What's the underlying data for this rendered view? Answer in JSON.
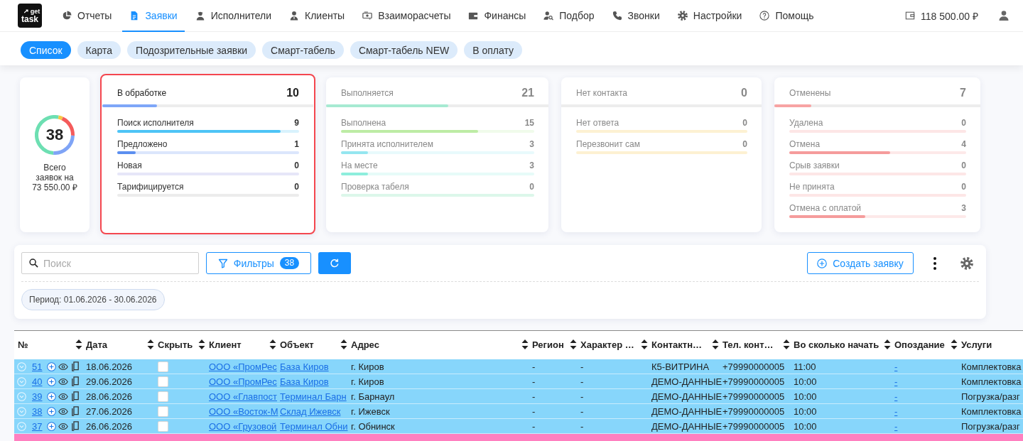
{
  "header": {
    "logo": {
      "top": "get",
      "bottom": "task"
    },
    "nav": [
      {
        "label": "Отчеты",
        "selected": false
      },
      {
        "label": "Заявки",
        "selected": true
      },
      {
        "label": "Исполнители",
        "selected": false
      },
      {
        "label": "Клиенты",
        "selected": false
      },
      {
        "label": "Взаиморасчеты",
        "selected": false
      },
      {
        "label": "Финансы",
        "selected": false
      },
      {
        "label": "Подбор",
        "selected": false
      },
      {
        "label": "Звонки",
        "selected": false
      },
      {
        "label": "Настройки",
        "selected": false
      },
      {
        "label": "Помощь",
        "selected": false
      }
    ],
    "balance": "118 500.00 ₽"
  },
  "view_tabs": [
    {
      "label": "Список",
      "selected": true
    },
    {
      "label": "Карта",
      "selected": false
    },
    {
      "label": "Подозрительные заявки",
      "selected": false
    },
    {
      "label": "Смарт-табель",
      "selected": false
    },
    {
      "label": "Смарт-табель NEW",
      "selected": false
    },
    {
      "label": "В оплату",
      "selected": false
    }
  ],
  "summary": {
    "total": {
      "count": "38",
      "caption": "Всего заявок на 73 550.00 ₽"
    },
    "groups": [
      {
        "title": "В обработке",
        "count": "10",
        "level": 0.26,
        "color": "#7ea6f8",
        "selected": true,
        "items": [
          {
            "label": "Поиск исполнителя",
            "count": "9",
            "level": 0.9,
            "color": "#4ec4f6"
          },
          {
            "label": "Предложено",
            "count": "1",
            "level": 0.1,
            "color": "#5b8ff0"
          },
          {
            "label": "Новая",
            "count": "0",
            "color": "#e6e6f8"
          },
          {
            "label": "Тарифицируется",
            "count": "0",
            "color": "#ececec"
          }
        ]
      },
      {
        "title": "Выполняется",
        "count": "21",
        "level": 0.55,
        "color": "#a6ead2",
        "selected": false,
        "items": [
          {
            "label": "Выполнена",
            "count": "15",
            "level": 0.71,
            "color": "#bdeca5"
          },
          {
            "label": "Принята исполнителем",
            "count": "3",
            "level": 0.14,
            "color": "#95e6f0"
          },
          {
            "label": "На месте",
            "count": "3",
            "level": 0.14,
            "color": "#8eeedd"
          },
          {
            "label": "Проверка табеля",
            "count": "0",
            "color": "#dcf7ea"
          }
        ]
      },
      {
        "title": "Нет контакта",
        "count": "0",
        "selected": false,
        "items": [
          {
            "label": "Нет ответа",
            "count": "0",
            "color": "#fdf1d2"
          },
          {
            "label": "Перезвонит сам",
            "count": "0",
            "color": "#fdf1d2"
          }
        ]
      },
      {
        "title": "Отменены",
        "count": "7",
        "level": 0.18,
        "color": "#f7a3a3",
        "selected": false,
        "items": [
          {
            "label": "Удалена",
            "count": "0",
            "color": "#fde6e6"
          },
          {
            "label": "Отмена",
            "count": "4",
            "level": 0.57,
            "color": "#f59c9c"
          },
          {
            "label": "Срыв заявки",
            "count": "0",
            "color": "#fde6e6"
          },
          {
            "label": "Не принята",
            "count": "0",
            "color": "#fde6e6"
          },
          {
            "label": "Отмена с оплатой",
            "count": "3",
            "level": 0.43,
            "color": "#f59c9c"
          }
        ]
      }
    ]
  },
  "toolbar": {
    "search_placeholder": "Поиск",
    "filters": {
      "label": "Фильтры",
      "count": "38"
    },
    "create_label": "Создать заявку",
    "period": "Период: 01.06.2026 - 30.06.2026"
  },
  "table": {
    "columns": [
      "№",
      "Дата",
      "Скрыть",
      "Клиент",
      "Объект",
      "Адрес",
      "Регион",
      "Характер …",
      "Контактн…",
      "Тел. конт…",
      "Во сколько начать",
      "Опоздание",
      "Услуги"
    ],
    "rows": [
      {
        "color": "#87d6fb",
        "number": "51",
        "date": "18.06.2026",
        "hidden": false,
        "client": "ООО «ПромРес",
        "object": "База Киров",
        "address": "г. Киров",
        "region": "-",
        "character": "-",
        "contact": "К5-ВИТРИНА",
        "phone": "+79990000005",
        "start_time": "11:00",
        "delay": "-",
        "services": "Комплектовка"
      },
      {
        "color": "#87d6fb",
        "number": "40",
        "date": "29.06.2026",
        "hidden": false,
        "client": "ООО «ПромРес",
        "object": "База Киров",
        "address": "г. Киров",
        "region": "-",
        "character": "-",
        "contact": "ДЕМО-ДАННЫЕ",
        "phone": "+79990000005",
        "start_time": "10:00",
        "delay": "-",
        "services": "Комплектовка"
      },
      {
        "color": "#87d6fb",
        "number": "39",
        "date": "28.06.2026",
        "hidden": false,
        "client": "ООО «Главпост",
        "object": "Терминал Барн",
        "address": "г. Барнаул",
        "region": "-",
        "character": "-",
        "contact": "ДЕМО-ДАННЫЕ",
        "phone": "+79990000005",
        "start_time": "10:00",
        "delay": "-",
        "services": "Погрузка/разг"
      },
      {
        "color": "#87d6fb",
        "number": "38",
        "date": "27.06.2026",
        "hidden": false,
        "client": "ООО «Восток-М",
        "object": "Склад Ижевск",
        "address": "г. Ижевск",
        "region": "-",
        "character": "-",
        "contact": "ДЕМО-ДАННЫЕ",
        "phone": "+79990000005",
        "start_time": "10:00",
        "delay": "-",
        "services": "Комплектовка"
      },
      {
        "color": "#87d6fb",
        "number": "37",
        "date": "26.06.2026",
        "hidden": false,
        "client": "ООО «Грузовой",
        "object": "Терминал Обни",
        "address": "г. Обнинск",
        "region": "-",
        "character": "-",
        "contact": "ДЕМО-ДАННЫЕ",
        "phone": "+79990000005",
        "start_time": "10:00",
        "delay": "-",
        "services": "Погрузка/разг"
      },
      {
        "color": "#ff80c0"
      }
    ]
  }
}
